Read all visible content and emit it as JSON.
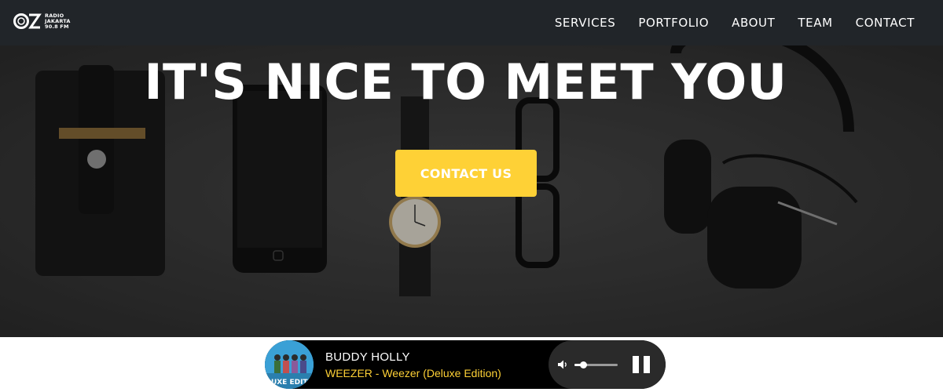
{
  "brand": {
    "logo_lines": [
      "RADIO",
      "JAKARTA",
      "90.8 FM"
    ]
  },
  "nav": {
    "items": [
      {
        "label": "SERVICES"
      },
      {
        "label": "PORTFOLIO"
      },
      {
        "label": "ABOUT"
      },
      {
        "label": "TEAM"
      },
      {
        "label": "CONTACT"
      }
    ]
  },
  "hero": {
    "title": "IT'S NICE TO MEET YOU",
    "cta_label": "CONTACT US"
  },
  "player": {
    "track_title": "BUDDY HOLLY",
    "track_artist": "WEEZER - Weezer (Deluxe Edition)",
    "album_art_text": "DELUXE EDITION",
    "volume_level": 0.2,
    "state": "playing"
  },
  "colors": {
    "nav_bg": "#212529",
    "accent": "#fed136",
    "player_bg": "#000000",
    "controls_bg": "#2a2a2a"
  },
  "icons": {
    "volume": "volume-icon",
    "pause": "pause-icon"
  }
}
